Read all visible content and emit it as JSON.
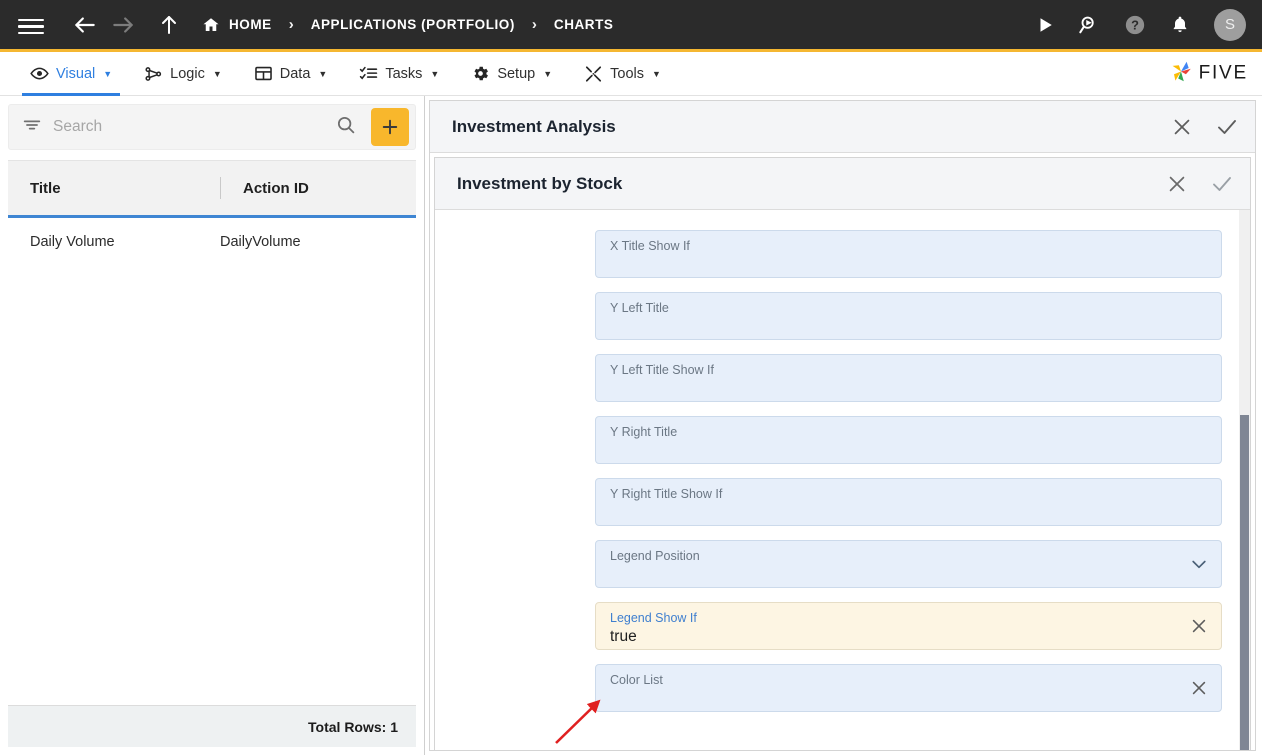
{
  "topbar": {
    "menu_icon": "hamburger-icon",
    "back_label": "back-arrow-icon",
    "forward_label": "forward-arrow-icon",
    "up_label": "up-arrow-icon",
    "breadcrumbs": [
      {
        "label": "HOME",
        "icon": "home-icon"
      },
      {
        "label": "APPLICATIONS (PORTFOLIO)",
        "icon": ""
      },
      {
        "label": "CHARTS",
        "icon": ""
      }
    ],
    "separator": "›",
    "actions": [
      {
        "name": "run-icon",
        "label": "Run"
      },
      {
        "name": "debug-icon",
        "label": "Debug"
      },
      {
        "name": "help-icon",
        "label": "Help"
      },
      {
        "name": "notifications-bell-icon",
        "label": "Notifications"
      }
    ],
    "avatar_initial": "S",
    "accent_color": "#f5b731",
    "background_color": "#2b2b2b"
  },
  "menubar": {
    "items": [
      {
        "label": "Visual",
        "icon": "eye-icon",
        "active": true
      },
      {
        "label": "Logic",
        "icon": "logic-nodes-icon",
        "active": false
      },
      {
        "label": "Data",
        "icon": "table-icon",
        "active": false
      },
      {
        "label": "Tasks",
        "icon": "checklist-icon",
        "active": false
      },
      {
        "label": "Setup",
        "icon": "gear-icon",
        "active": false
      },
      {
        "label": "Tools",
        "icon": "tools-icon",
        "active": false
      }
    ],
    "caret": "▼",
    "active_color": "#2f7fe0",
    "brand": "FIVE"
  },
  "sidebar": {
    "search": {
      "placeholder": "Search",
      "value": ""
    },
    "filter_icon": "filter-icon",
    "search_icon": "search-icon",
    "add_button_label": "+",
    "add_button_color": "#f8b72c",
    "grid": {
      "columns": [
        "Title",
        "Action ID"
      ],
      "rows": [
        {
          "title": "Daily Volume",
          "action_id": "DailyVolume"
        }
      ]
    },
    "footer": {
      "total_rows_label": "Total Rows: 1"
    }
  },
  "main": {
    "outer_card": {
      "title": "Investment Analysis",
      "close_icon": "close-icon",
      "confirm_icon": "check-icon"
    },
    "inner_card": {
      "title": "Investment by Stock",
      "close_icon": "close-icon",
      "confirm_icon": "check-icon"
    },
    "fields": [
      {
        "label": "X Title Show If",
        "value": "",
        "type": "text",
        "highlight": false,
        "action": ""
      },
      {
        "label": "Y Left Title",
        "value": "",
        "type": "text",
        "highlight": false,
        "action": ""
      },
      {
        "label": "Y Left Title Show If",
        "value": "",
        "type": "text",
        "highlight": false,
        "action": ""
      },
      {
        "label": "Y Right Title",
        "value": "",
        "type": "text",
        "highlight": false,
        "action": ""
      },
      {
        "label": "Y Right Title Show If",
        "value": "",
        "type": "text",
        "highlight": false,
        "action": ""
      },
      {
        "label": "Legend Position",
        "value": "",
        "type": "dropdown",
        "highlight": false,
        "action": "chevron-down-icon"
      },
      {
        "label": "Legend Show If",
        "value": "true",
        "type": "text",
        "highlight": true,
        "action": "clear-icon"
      },
      {
        "label": "Color List",
        "value": "",
        "type": "text",
        "highlight": false,
        "action": "clear-icon"
      }
    ],
    "annotation": {
      "type": "red-arrow",
      "points_to": "Color List",
      "color": "#e02020"
    },
    "field_bg_color": "#e7effa",
    "field_highlight_color": "#fdf5e3"
  }
}
